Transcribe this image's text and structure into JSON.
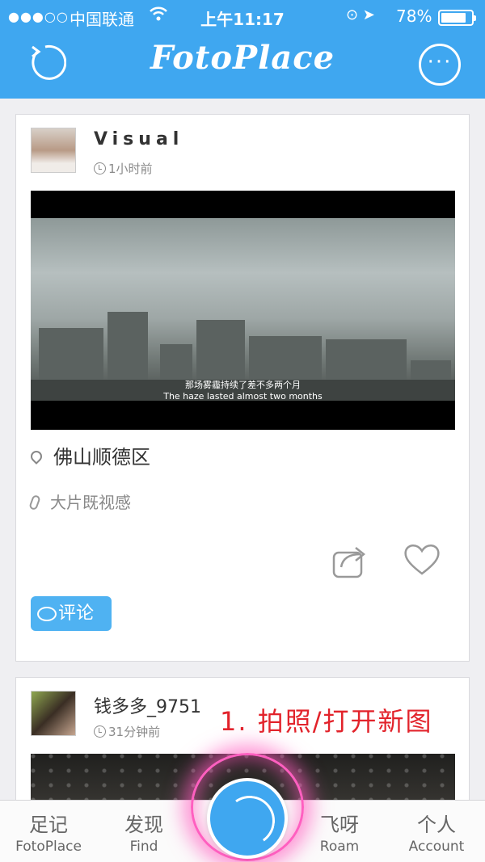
{
  "status_bar": {
    "signal": "●●●○○",
    "carrier": "中国联通",
    "wifi_icon": "wifi-icon",
    "time": "上午11:17",
    "right_icons": "⊙ ➤",
    "battery": "78%"
  },
  "nav": {
    "title": "FotoPlace",
    "more": "···",
    "colors": {
      "bar": "#3fa7f0"
    }
  },
  "posts": [
    {
      "author": "Visual",
      "time": "1小时前",
      "photo_subtitle_cn": "那场雾霾持续了差不多两个月",
      "photo_subtitle_en": "The haze lasted almost two months",
      "location": "佛山顺德区",
      "tag": "大片既视感",
      "comment_label": "评论"
    },
    {
      "author": "钱多多_9751",
      "time": "31分钟前"
    }
  ],
  "annotation": "1. 拍照/打开新图",
  "tabs": [
    {
      "cn": "足记",
      "en": "FotoPlace"
    },
    {
      "cn": "发现",
      "en": "Find"
    },
    {
      "cn": "飞呀",
      "en": "Roam"
    },
    {
      "cn": "个人",
      "en": "Account"
    }
  ]
}
